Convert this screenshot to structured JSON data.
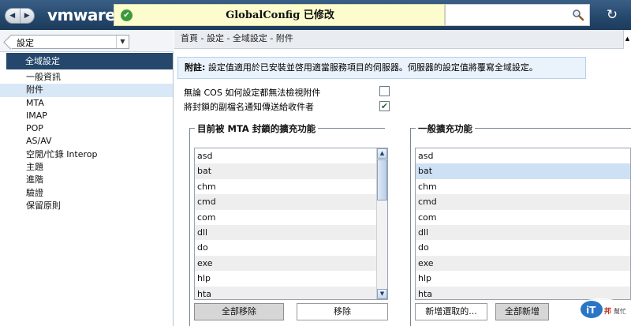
{
  "topbar": {
    "logo": "vmware",
    "notice": "GlobalConfig 已修改",
    "search_placeholder": ""
  },
  "sidebar": {
    "back_label": "設定",
    "group_label": "全域設定",
    "items": [
      {
        "label": "一般資訊"
      },
      {
        "label": "附件"
      },
      {
        "label": "MTA"
      },
      {
        "label": "IMAP"
      },
      {
        "label": "POP"
      },
      {
        "label": "AS/AV"
      },
      {
        "label": "空閒/忙錄 Interop"
      },
      {
        "label": "主題"
      },
      {
        "label": "進階"
      },
      {
        "label": "驗證"
      },
      {
        "label": "保留原則"
      }
    ],
    "selected_index": 1
  },
  "main": {
    "breadcrumb": "首頁 - 設定 - 全域設定 - 附件",
    "note_bold": "附註:",
    "note_text": " 設定值適用於已安裝並啓用適當服務項目的伺服器。伺服器的設定值將覆寫全域設定。",
    "options": [
      {
        "label": "無論 COS 如何設定都無法檢視附件",
        "checked": false
      },
      {
        "label": "將封鎖的副檔名通知傳送給收件者",
        "checked": true
      }
    ],
    "blocked": {
      "legend": "目前被 MTA 封鎖的擴充功能",
      "items": [
        "asd",
        "bat",
        "chm",
        "cmd",
        "com",
        "dll",
        "do",
        "exe",
        "hlp",
        "hta"
      ],
      "remove_all_label": "全部移除",
      "remove_label": "移除"
    },
    "general": {
      "legend": "一般擴充功能",
      "items": [
        "asd",
        "bat",
        "chm",
        "cmd",
        "com",
        "dll",
        "do",
        "exe",
        "hlp",
        "hta"
      ],
      "selected": "bat",
      "add_selected_label": "新增選取的...",
      "add_all_label": "全部新增"
    }
  },
  "colors": {
    "topbar": "#24476b",
    "notice_bg": "#fcfccf",
    "selected_row": "#cde0f4",
    "note_bg": "#eaf2fb"
  }
}
